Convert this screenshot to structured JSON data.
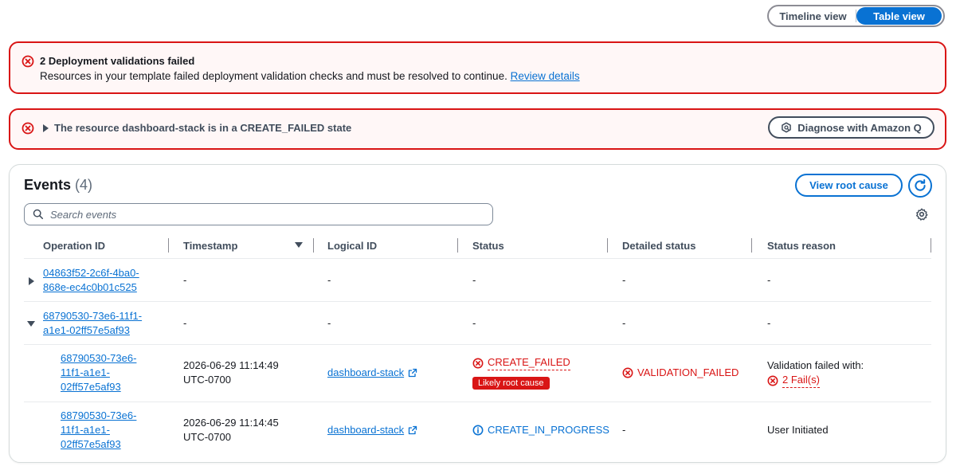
{
  "view_toggle": {
    "timeline_label": "Timeline view",
    "table_label": "Table view",
    "active": "table"
  },
  "alerts": [
    {
      "title": "2 Deployment validations failed",
      "body": "Resources in your template failed deployment validation checks and must be resolved to continue.",
      "link": "Review details"
    },
    {
      "text": "The resource dashboard-stack is in a CREATE_FAILED state",
      "button": "Diagnose with Amazon Q"
    }
  ],
  "events": {
    "title": "Events",
    "count": "(4)",
    "view_root_cause": "View root cause",
    "search_placeholder": "Search events",
    "columns": [
      "Operation ID",
      "Timestamp",
      "Logical ID",
      "Status",
      "Detailed status",
      "Status reason"
    ],
    "rows": [
      {
        "op_id_lines": [
          "04863f52-2c6f-4ba0-",
          "868e-ec4c0b01c525"
        ],
        "timestamp": "-",
        "logical_id": "-",
        "status": "-",
        "detailed": "-",
        "reason": "-"
      },
      {
        "op_id_lines": [
          "68790530-73e6-11f1-",
          "a1e1-02ff57e5af93"
        ],
        "timestamp": "-",
        "logical_id": "-",
        "status": "-",
        "detailed": "-",
        "reason": "-"
      },
      {
        "op_id_lines": [
          "68790530-73e6-",
          "11f1-a1e1-",
          "02ff57e5af93"
        ],
        "timestamp_lines": [
          "2026-06-29 11:14:49",
          "UTC-0700"
        ],
        "logical_id": "dashboard-stack",
        "status": "CREATE_FAILED",
        "badge": "Likely root cause",
        "detailed": "VALIDATION_FAILED",
        "reason": "Validation failed with:",
        "reason_link": "2 Fail(s)"
      },
      {
        "op_id_lines": [
          "68790530-73e6-",
          "11f1-a1e1-",
          "02ff57e5af93"
        ],
        "timestamp_lines": [
          "2026-06-29 11:14:45",
          "UTC-0700"
        ],
        "logical_id": "dashboard-stack",
        "status": "CREATE_IN_PROGRESS",
        "detailed": "-",
        "reason": "User Initiated"
      }
    ]
  },
  "colors": {
    "error": "#d91515",
    "link": "#0972d3",
    "alert_bg": "#fff7f7"
  }
}
